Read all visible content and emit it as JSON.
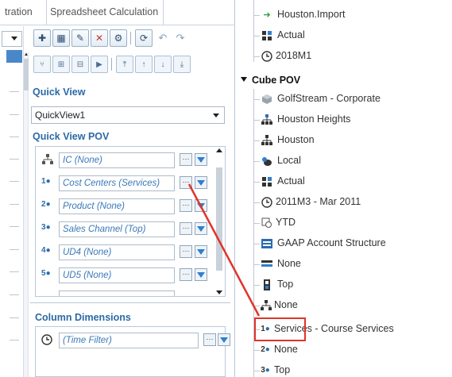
{
  "tabs": [
    "tration",
    "Spreadsheet Calculation"
  ],
  "quick_view": {
    "title": "Quick View",
    "selected": "QuickView1"
  },
  "quick_view_pov": {
    "title": "Quick View POV",
    "rows": [
      {
        "icon": "intercompany-icon",
        "value": "IC (None)"
      },
      {
        "icon": "ud1-icon",
        "value": "Cost Centers (Services)"
      },
      {
        "icon": "ud2-icon",
        "value": "Product (None)"
      },
      {
        "icon": "ud3-icon",
        "value": "Sales Channel (Top)"
      },
      {
        "icon": "ud4-icon",
        "value": "UD4 (None)"
      },
      {
        "icon": "ud5-icon",
        "value": "UD5 (None)"
      }
    ]
  },
  "column_dimensions": {
    "title": "Column Dimensions",
    "rows": [
      {
        "icon": "clock-icon",
        "value": "(Time Filter)"
      }
    ]
  },
  "tree": {
    "pre_items": [
      {
        "icon": "green-arrow-icon",
        "label": "Houston.Import"
      },
      {
        "icon": "scenario-icon",
        "label": "Actual"
      },
      {
        "icon": "clock-icon",
        "label": "2018M1"
      }
    ],
    "cube_pov_label": "Cube POV",
    "cube_items": [
      {
        "icon": "cube-icon",
        "label": "GolfStream - Corporate"
      },
      {
        "icon": "entity-icon",
        "label": "Houston Heights"
      },
      {
        "icon": "entity-icon",
        "label": "Houston"
      },
      {
        "icon": "consolidation-icon",
        "label": "Local"
      },
      {
        "icon": "scenario-icon",
        "label": "Actual"
      },
      {
        "icon": "clock-icon",
        "label": "2011M3 - Mar 2011"
      },
      {
        "icon": "view-icon",
        "label": "YTD"
      },
      {
        "icon": "account-icon",
        "label": "GAAP Account Structure"
      },
      {
        "icon": "flow-icon",
        "label": "None"
      },
      {
        "icon": "origin-icon",
        "label": "Top"
      },
      {
        "icon": "intercompany-icon",
        "label": "None"
      },
      {
        "icon": "ud1-icon",
        "label": "Services - Course Services"
      },
      {
        "icon": "ud2-icon",
        "label": "None"
      },
      {
        "icon": "ud3-icon",
        "label": "Top"
      }
    ]
  },
  "colors": {
    "accent": "#2b6aa6",
    "highlight": "#e0342b"
  }
}
